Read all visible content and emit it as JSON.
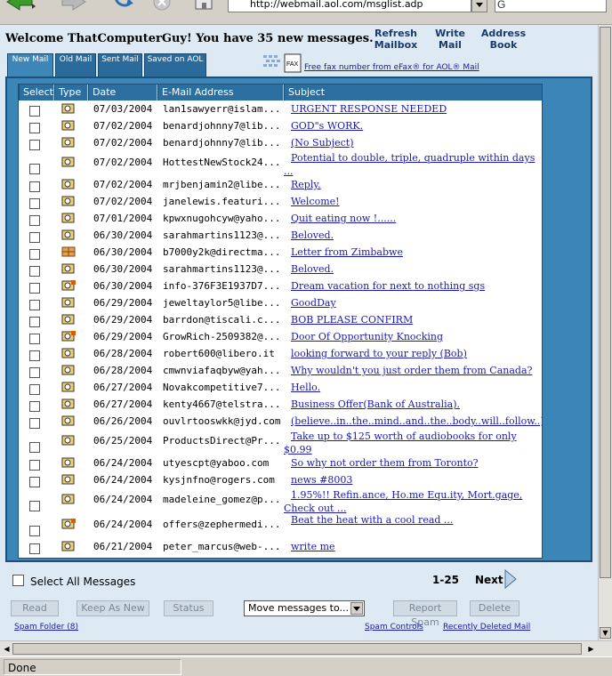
{
  "browser": {
    "url": "http://webmail.aol.com/msglist.adp",
    "status": "Done"
  },
  "header": {
    "welcome": "Welcome ThatComputerGuy!  You have 35 new messages.",
    "nav": {
      "refresh": "Refresh Mailbox",
      "write": "Write Mail",
      "address": "Address Book"
    }
  },
  "tabs": {
    "new": "New Mail",
    "old": "Old Mail",
    "sent": "Sent Mail",
    "saved": "Saved on AOL"
  },
  "fax_link": "Free fax number from eFax® for AOL® Mail",
  "columns": {
    "select": "Select",
    "type": "Type",
    "date": "Date",
    "email": "E-Mail Address",
    "subject": "Subject"
  },
  "messages": [
    {
      "date": "07/03/2004",
      "from": "lan1sawyerr@islam...",
      "subject": "URGENT RESPONSE NEEDED"
    },
    {
      "date": "07/02/2004",
      "from": "benardjohnny7@lib...",
      "subject": "GOD\"s WORK."
    },
    {
      "date": "07/02/2004",
      "from": "benardjohnny7@lib...",
      "subject": "(No Subject)"
    },
    {
      "date": "07/02/2004",
      "from": "HottestNewStock24...",
      "subject": "Potential to double, triple, quadruple within days ..."
    },
    {
      "date": "07/02/2004",
      "from": "mrjbenjamin2@libe...",
      "subject": "Reply."
    },
    {
      "date": "07/02/2004",
      "from": "janelewis.featuri...",
      "subject": "Welcome!"
    },
    {
      "date": "07/01/2004",
      "from": "kpwxnugohcyw@yaho...",
      "subject": "Quit eating now !......"
    },
    {
      "date": "06/30/2004",
      "from": "sarahmartins1123@...",
      "subject": "Beloved."
    },
    {
      "date": "06/30/2004",
      "from": "b7000y2k@directma...",
      "subject": "Letter from Zimbabwe"
    },
    {
      "date": "06/30/2004",
      "from": "sarahmartins1123@...",
      "subject": "Beloved."
    },
    {
      "date": "06/30/2004",
      "from": "info-376F3E1937D7...",
      "subject": "Dream vacation for next to nothing sgs"
    },
    {
      "date": "06/29/2004",
      "from": "jeweltaylor5@libe...",
      "subject": "GoodDay"
    },
    {
      "date": "06/29/2004",
      "from": "barrdon@tiscali.c...",
      "subject": "BOB PLEASE CONFIRM"
    },
    {
      "date": "06/29/2004",
      "from": "GrowRich-2509382@...",
      "subject": "Door Of Opportunity Knocking"
    },
    {
      "date": "06/28/2004",
      "from": "robert600@libero.it",
      "subject": "looking forward to your reply (Bob)"
    },
    {
      "date": "06/28/2004",
      "from": "cmwnviafaqbyw@yah...",
      "subject": "Why wouldn't you just order them from Canada?"
    },
    {
      "date": "06/27/2004",
      "from": "Novakcompetitive7...",
      "subject": "Hello."
    },
    {
      "date": "06/27/2004",
      "from": "kenty4667@telstra...",
      "subject": "Business Offer(Bank of Australia)."
    },
    {
      "date": "06/26/2004",
      "from": "ouvlrtooswkk@jyd.com",
      "subject": "(believe..in..the..mind..and..the..body..will..follow..)"
    },
    {
      "date": "06/25/2004",
      "from": "ProductsDirect@Pr...",
      "subject": "Take up to $125 worth of audiobooks for only $0.99"
    },
    {
      "date": "06/24/2004",
      "from": "utyescpt@yaboo.com",
      "subject": "So why not order them from Toronto?"
    },
    {
      "date": "06/24/2004",
      "from": "kysjnfno@rogers.com",
      "subject": "news #8003"
    },
    {
      "date": "06/24/2004",
      "from": "madeleine_gomez@p...",
      "subject": "1.95%!!  Refin.ance, Ho.me Equ.ity, Mort.gage, Check out ..."
    },
    {
      "date": "06/24/2004",
      "from": "offers@zephermedi...",
      "subject": "Beat the heat with a cool read ..."
    },
    {
      "date": "06/21/2004",
      "from": "peter_marcus@web-...",
      "subject": "write me"
    }
  ],
  "footer": {
    "select_all": "Select All Messages",
    "page_range": "1-25",
    "next": "Next",
    "buttons": {
      "read": "Read",
      "keep": "Keep As New",
      "status": "Status",
      "report": "Report Spam",
      "delete": "Delete"
    },
    "move": "Move messages to...",
    "links": {
      "spam_folder": "Spam Folder (8)",
      "spam_controls": "Spam Controls",
      "recent_deleted": "Recently Deleted Mail"
    }
  }
}
